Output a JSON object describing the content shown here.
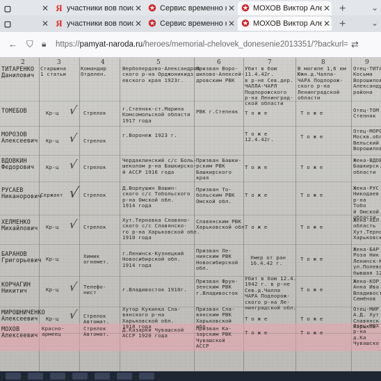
{
  "browser": {
    "tabs_row1": [
      {
        "label": "",
        "icon": "tab-icon",
        "active": false
      },
      {
        "label": "участники вов поиск п",
        "icon": "yandex-icon",
        "active": false
      },
      {
        "label": "Сервис временно недо",
        "icon": "star-icon",
        "active": false
      },
      {
        "label": "МОХОВ Виктор Алексе",
        "icon": "star-icon",
        "active": true
      }
    ],
    "tabs_row2": [
      {
        "label": "",
        "icon": "tab-icon",
        "active": false
      },
      {
        "label": "участники вов поиск п",
        "icon": "yandex-icon",
        "active": false
      },
      {
        "label": "Сервис временно недо",
        "icon": "star-icon",
        "active": false
      },
      {
        "label": "МОХОВ Виктор Алексе",
        "icon": "star-icon",
        "active": true
      }
    ],
    "url_prefix": "https://",
    "url_host": "pamyat-naroda.ru",
    "url_path": "/heroes/memorial-chelovek_donesenie2013351/?backurl="
  },
  "document": {
    "column_numbers": [
      "2",
      "3",
      "4",
      "5",
      "6",
      "7",
      "8",
      "9"
    ],
    "header_cells": {
      "name": "ТИТАРЕНКО\nДанилович",
      "rank": "Старшина\n1 статьи",
      "position": "Командир\nОтделен.",
      "birth": "Вербопердово-Александров-\nского р-на Орджоникидз\nевского края 1923г.",
      "drafted": "Призван Воро-\nшилово-Алексей-\nдровским РВК",
      "fate": "Убит в бою\n11.4.42г.\nв р-не Сев.дер.\nЧАЛЛА-ЧАРЛ\nПодпорожского\nр-на Ленинград-\nской области",
      "burial": "В могиле 1,6 км\nЮжн.д.Чалла-\nЧАРА Подпорож-\nского р-на\nЛенинградской\nобласти",
      "relative": "Отец-ТИТА\nКосьма\nВорошилов\nАлександр\nрайона"
    },
    "rows": [
      {
        "name": "ТОМЕБОВ\n",
        "rank": "Кр-ц",
        "position": "Стрелок",
        "birth": "г.Степняк-ст.Марина\nКомсомольской области\n1917 года",
        "drafted": "РВК  г.Степняк",
        "fate": "Т о ж е",
        "burial": "Т о ж е",
        "relative": "Отец-ТОМ\nСтепняк"
      },
      {
        "name": "МОРОЗОВ\nАлексеевич",
        "rank": "Кр-ц",
        "position": "Стрелок",
        "birth": "г.Воронеж 1923 г.",
        "drafted": "",
        "fate": "Т о ж е\n12.4.42г.",
        "burial": "Т о ж е",
        "relative": "Отец-МОРО\nМоскв.обл\nВельский\nВорошилов"
      },
      {
        "name": "ВДОВКИН\nФедорович",
        "rank": "Кр-ц",
        "position": "Стрелок",
        "birth": "Чердаклинский с/с Боль-\nшеколом р-на Башкирско-\nй АССР 1916 года",
        "drafted": "Призван Башки-\nрским РВК\nБашкирского\nкрая",
        "fate": "Т о ж е",
        "burial": "Т о ж е",
        "relative": "Жена-ВДОВ\nБашкирск.\nобласти"
      },
      {
        "name": "РУСАЕВ\nНиканорович",
        "rank": "Сержант",
        "position": "Стрелок",
        "birth": "Д.Ворлушин Вашин-\nского с/с Тобольского\nр-на Омской обл.\n1914 года",
        "drafted": "Призван То-\nбольским РВК\nОмской обл.",
        "fate": "Т о ж е",
        "burial": "Т о ж е",
        "relative": "Жена-РУС\nНикодаев\nр-на Тобо\nй Омской\nобласти"
      },
      {
        "name": "ХЕЛМЕНКО\nМихайлович",
        "rank": "Кр-ц",
        "position": "Стрелок",
        "birth": "Хут.Терновка Славяно-\nского с/с Славянско-\nго р-на Харьковской обл.\n1910 года",
        "drafted": "Славянским РВК\nХарьковской обл.",
        "fate": "Т о ж е",
        "burial": "Т о ж е",
        "relative": "Жена-ХЕЛ\nобласть\nХут.Терно\nХарьковской"
      },
      {
        "name": "БАРАНОВ\nГригорьевич",
        "rank": "Кр-ц",
        "position": "Химик\nогнемет.",
        "birth": "г.Ленинск-Кузнецкий\nНовосибирской обл.\n1914 года",
        "drafted": "Призван Ле-\nнинским РВК\nНовосибирской\nобл.",
        "fate": "Умер от ран\n16.4.42 г.",
        "burial": "Т о ж е",
        "relative": "Жена-БАР\nРоза Ник\nЛенинск-К\nул.Полево\nбывшая 12"
      },
      {
        "name": "КОРЧАГИН\nНикитич",
        "rank": "Кр-ц",
        "position": "Телефо-\nнист",
        "birth": "г.Владивосток 1910г.",
        "drafted": "Призван Фрун-\nзенским РВК\nг.Владивосток",
        "fate": "Убит в бою 12.4.\n1942 г. в р-не\nСев.д.Чалла\nЧАРА Подпорож-\nского р-на Ле-\nнинградской обл.",
        "burial": "Т о ж е",
        "relative": "Жена-КОР\nАнна Ива\nВладивост\nСемёнов"
      },
      {
        "name": "МИРОШНИЧЕНКО\nАлексеевич",
        "rank": "Кр-ц",
        "position": "Стрелок\nАвтомат.",
        "birth": "Хутор Кукинка Сла-\nвянского р-на\nХарьковской обл.\n1918 года",
        "drafted": "Призван Сла-\nвянским РВК\nХарьковской\nобл.",
        "fate": "Т о ж е",
        "burial": "Т о ж е",
        "relative": "Отец-МИР\nА.Д. Хут\nСлавянск\nХарьков"
      },
      {
        "name": "МОХОВ\nАлексеевич",
        "rank": "Красно-\nармеец",
        "position": "Стрелок\nАвтомат.",
        "birth": "Д.Казарки Чувашской\nАССР 1920 года",
        "drafted": "Призван Ка-\nзарским РВК\nЧувашской\nАССР",
        "fate": "Т о ж е",
        "burial": "Т о ж е",
        "relative": "Отец-МОХ\nр-на д.Ка\nЧувашско"
      }
    ]
  }
}
